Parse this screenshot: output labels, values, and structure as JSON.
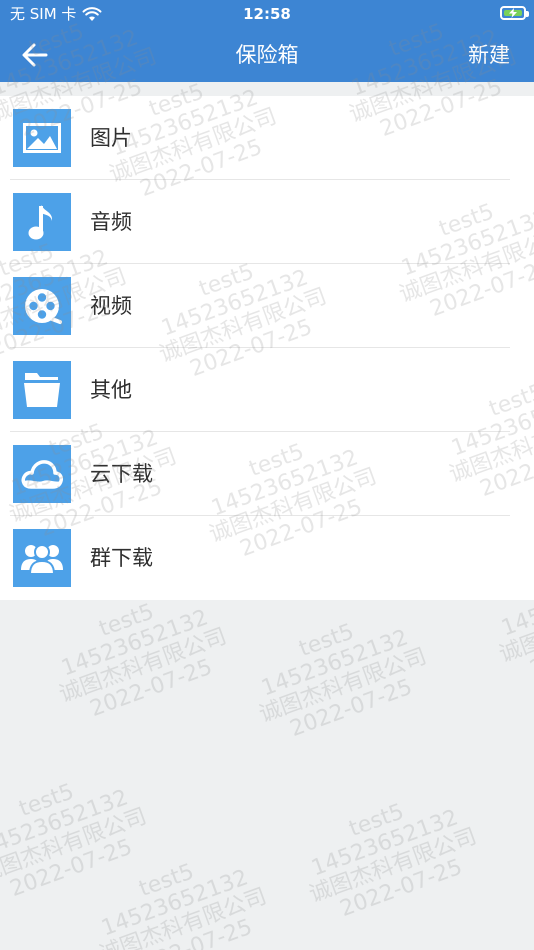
{
  "status_bar": {
    "carrier": "无 SIM 卡",
    "time": "12:58"
  },
  "navbar": {
    "title": "保险箱",
    "new_label": "新建"
  },
  "items": [
    {
      "label": "图片",
      "icon": "image-icon"
    },
    {
      "label": "音频",
      "icon": "music-note-icon"
    },
    {
      "label": "视频",
      "icon": "video-reel-icon"
    },
    {
      "label": "其他",
      "icon": "folder-icon"
    },
    {
      "label": "云下载",
      "icon": "cloud-icon"
    },
    {
      "label": "群下载",
      "icon": "group-icon"
    }
  ],
  "watermark": {
    "line1": "test5",
    "line2": "14523652132",
    "line3": "诚图杰科有限公司",
    "line4": "2022-07-25"
  },
  "colors": {
    "header": "#3d85d3",
    "icon_bg": "#4da1e8",
    "background": "#eef0f1"
  }
}
